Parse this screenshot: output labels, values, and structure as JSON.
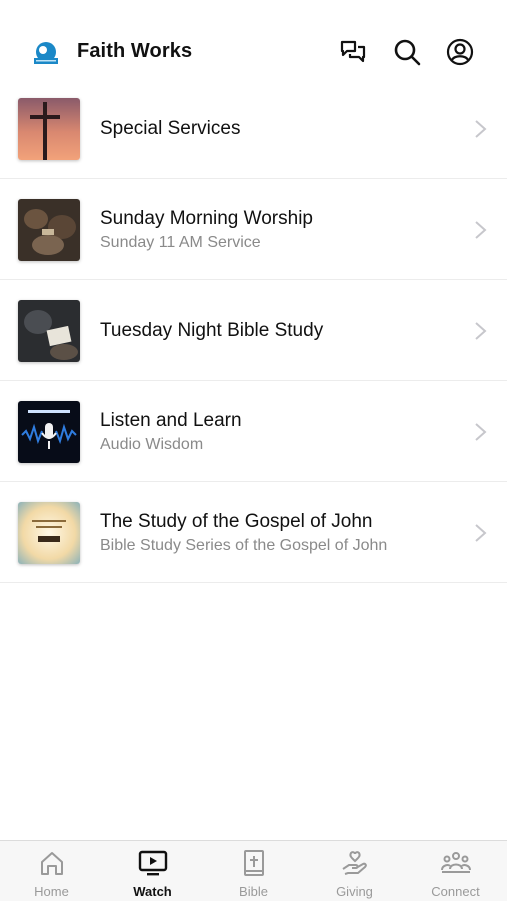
{
  "header": {
    "title": "Faith Works",
    "icons": [
      "logo-icon",
      "chat-icon",
      "search-icon",
      "account-icon"
    ]
  },
  "items": [
    {
      "title": "Special Services",
      "subtitle": "",
      "thumb": "cross-sunset"
    },
    {
      "title": "Sunday Morning Worship",
      "subtitle": "Sunday 11 AM Service",
      "thumb": "praying-group"
    },
    {
      "title": "Tuesday Night Bible Study",
      "subtitle": "",
      "thumb": "bible-reading"
    },
    {
      "title": "Listen and Learn",
      "subtitle": "Audio Wisdom",
      "thumb": "microphone-waveform"
    },
    {
      "title": "The Study of the Gospel of John",
      "subtitle": "Bible Study Series of the Gospel of John",
      "thumb": "gospel-light"
    }
  ],
  "tabs": [
    {
      "label": "Home",
      "icon": "home-icon",
      "active": false
    },
    {
      "label": "Watch",
      "icon": "tv-play-icon",
      "active": true
    },
    {
      "label": "Bible",
      "icon": "bible-icon",
      "active": false
    },
    {
      "label": "Giving",
      "icon": "giving-hand-icon",
      "active": false
    },
    {
      "label": "Connect",
      "icon": "people-icon",
      "active": false
    }
  ],
  "colors": {
    "text_primary": "#111111",
    "text_secondary": "#8a8a8a",
    "tab_inactive": "#9a9a9a",
    "logo_blue": "#1b88c7"
  }
}
